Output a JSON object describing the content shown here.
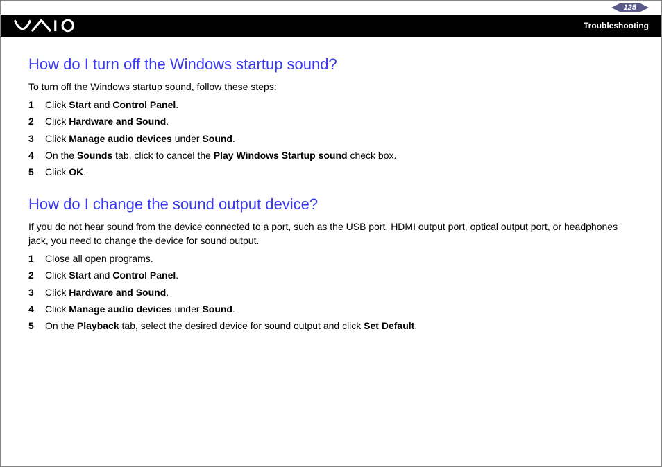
{
  "header": {
    "page_number": "125",
    "section": "Troubleshooting"
  },
  "sections": [
    {
      "heading": "How do I turn off the Windows startup sound?",
      "intro": "To turn off the Windows startup sound, follow these steps:",
      "steps": [
        {
          "n": "1",
          "pre": "Click ",
          "b1": "Start",
          "mid": " and ",
          "b2": "Control Panel",
          "post": "."
        },
        {
          "n": "2",
          "pre": "Click ",
          "b1": "Hardware and Sound",
          "mid": "",
          "b2": "",
          "post": "."
        },
        {
          "n": "3",
          "pre": "Click ",
          "b1": "Manage audio devices",
          "mid": " under ",
          "b2": "Sound",
          "post": "."
        },
        {
          "n": "4",
          "pre": "On the ",
          "b1": "Sounds",
          "mid": " tab, click to cancel the ",
          "b2": "Play Windows Startup sound",
          "post": " check box."
        },
        {
          "n": "5",
          "pre": "Click ",
          "b1": "OK",
          "mid": "",
          "b2": "",
          "post": "."
        }
      ]
    },
    {
      "heading": "How do I change the sound output device?",
      "intro": "If you do not hear sound from the device connected to a port, such as the USB port, HDMI output port, optical output port, or headphones jack, you need to change the device for sound output.",
      "steps": [
        {
          "n": "1",
          "pre": "Close all open programs.",
          "b1": "",
          "mid": "",
          "b2": "",
          "post": ""
        },
        {
          "n": "2",
          "pre": "Click ",
          "b1": "Start",
          "mid": " and ",
          "b2": "Control Panel",
          "post": "."
        },
        {
          "n": "3",
          "pre": "Click ",
          "b1": "Hardware and Sound",
          "mid": "",
          "b2": "",
          "post": "."
        },
        {
          "n": "4",
          "pre": "Click ",
          "b1": "Manage audio devices",
          "mid": " under ",
          "b2": "Sound",
          "post": "."
        },
        {
          "n": "5",
          "pre": "On the ",
          "b1": "Playback",
          "mid": " tab, select the desired device for sound output and click ",
          "b2": "Set Default",
          "post": "."
        }
      ]
    }
  ]
}
